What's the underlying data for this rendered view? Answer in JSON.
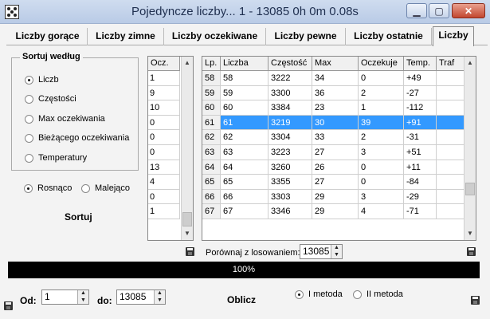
{
  "window": {
    "title": "Pojedyncze liczby... 1 - 13085   0h 0m 0.08s",
    "min_glyph": "▁",
    "max_glyph": "▢",
    "close_glyph": "✕"
  },
  "tabs": [
    "Liczby gorące",
    "Liczby zimne",
    "Liczby oczekiwane",
    "Liczby pewne",
    "Liczby ostatnie",
    "Liczby"
  ],
  "active_tab": 5,
  "sort_group": {
    "title": "Sortuj według",
    "options": [
      "Liczb",
      "Częstości",
      "Max oczekiwania",
      "Bieżącego oczekiwania",
      "Temperatury"
    ],
    "selected": 0
  },
  "order": {
    "asc": "Rosnąco",
    "desc": "Malejąco",
    "selected": "asc"
  },
  "sort_button": "Sortuj",
  "ocz_list": {
    "header": "Ocz.",
    "values": [
      "1",
      "9",
      "10",
      "0",
      "0",
      "0",
      "13",
      "4",
      "0",
      "1"
    ]
  },
  "grid": {
    "headers": [
      "Lp.",
      "Liczba",
      "Częstość",
      "Max",
      "Oczekuje",
      "Temp.",
      "Traf"
    ],
    "rows": [
      [
        "58",
        "58",
        "3222",
        "34",
        "0",
        "+49",
        ""
      ],
      [
        "59",
        "59",
        "3300",
        "36",
        "2",
        "-27",
        ""
      ],
      [
        "60",
        "60",
        "3384",
        "23",
        "1",
        "-112",
        ""
      ],
      [
        "61",
        "61",
        "3219",
        "30",
        "39",
        "+91",
        ""
      ],
      [
        "62",
        "62",
        "3304",
        "33",
        "2",
        "-31",
        ""
      ],
      [
        "63",
        "63",
        "3223",
        "27",
        "3",
        "+51",
        ""
      ],
      [
        "64",
        "64",
        "3260",
        "26",
        "0",
        "+11",
        ""
      ],
      [
        "65",
        "65",
        "3355",
        "27",
        "0",
        "-84",
        ""
      ],
      [
        "66",
        "66",
        "3303",
        "29",
        "3",
        "-29",
        ""
      ],
      [
        "67",
        "67",
        "3346",
        "29",
        "4",
        "-71",
        ""
      ]
    ],
    "selected_row": 3
  },
  "compare": {
    "label": "Porównaj z losowaniem:",
    "value": "13085"
  },
  "progress": {
    "text": "100%",
    "percent": 100
  },
  "range": {
    "from_label": "Od:",
    "from_value": "1",
    "to_label": "do:",
    "to_value": "13085"
  },
  "calc_button": "Oblicz",
  "method": {
    "first": "I metoda",
    "second": "II metoda",
    "selected": "first"
  },
  "arrows": {
    "up": "▲",
    "down": "▼"
  }
}
